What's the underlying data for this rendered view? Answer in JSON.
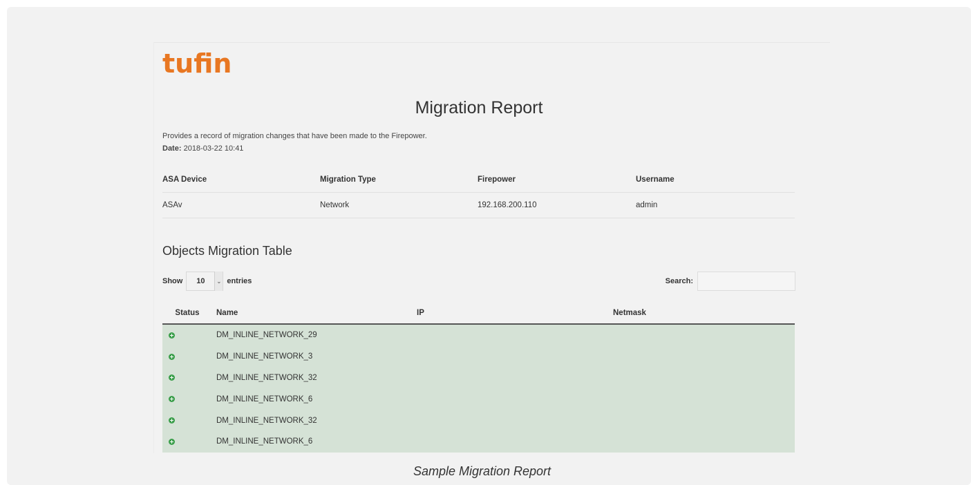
{
  "logo": "tufin",
  "report": {
    "title": "Migration Report",
    "description": "Provides a record of migration changes that have been made to the Firepower.",
    "date_label": "Date:",
    "date_value": "2018-03-22 10:41"
  },
  "info_table": {
    "headers": [
      "ASA Device",
      "Migration Type",
      "Firepower",
      "Username"
    ],
    "row": [
      "ASAv",
      "Network",
      "192.168.200.110",
      "admin"
    ]
  },
  "objects": {
    "section_title": "Objects Migration Table",
    "show_label": "Show",
    "entries_value": "10",
    "entries_label": "entries",
    "search_label": "Search:",
    "search_value": "",
    "headers": [
      "Status",
      "Name",
      "IP",
      "Netmask"
    ],
    "rows": [
      {
        "status": "added",
        "name": "DM_INLINE_NETWORK_29",
        "ip": "",
        "netmask": ""
      },
      {
        "status": "added",
        "name": "DM_INLINE_NETWORK_3",
        "ip": "",
        "netmask": ""
      },
      {
        "status": "added",
        "name": "DM_INLINE_NETWORK_32",
        "ip": "",
        "netmask": ""
      },
      {
        "status": "added",
        "name": "DM_INLINE_NETWORK_6",
        "ip": "",
        "netmask": ""
      },
      {
        "status": "added",
        "name": "DM_INLINE_NETWORK_32",
        "ip": "",
        "netmask": ""
      },
      {
        "status": "added",
        "name": "DM_INLINE_NETWORK_6",
        "ip": "",
        "netmask": ""
      }
    ],
    "status_icon": "plus-circle-icon",
    "row_color": "#d5e2d6",
    "status_color": "#3a9e4a"
  },
  "caption": "Sample Migration Report",
  "colors": {
    "brand": "#e87722"
  }
}
